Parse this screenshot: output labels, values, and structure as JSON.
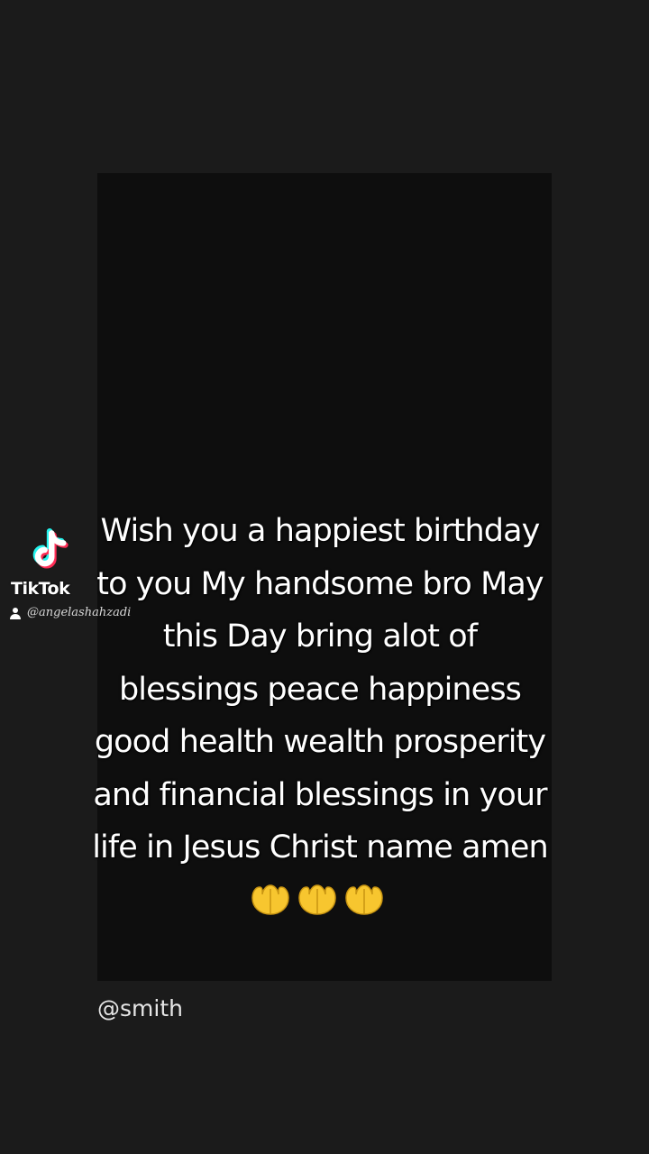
{
  "caption": {
    "lines": [
      "Wish you a happiest birthday",
      "to you My handsome bro May",
      "this Day bring alot of",
      "blessings peace happiness",
      "good health wealth prosperity",
      "and financial blessings in your",
      "life in Jesus Christ name amen"
    ],
    "emoji": [
      "palms-up-together-icon",
      "palms-up-together-icon",
      "palms-up-together-icon"
    ]
  },
  "watermark": {
    "brand": "TikTok",
    "username": "@angelashahzadi",
    "icon": "tiktok-logo-icon",
    "user_icon": "user-icon"
  },
  "mention": "@smith",
  "colors": {
    "background": "#1b1b1b",
    "video_frame": "#0e0e0e",
    "text": "#ffffff",
    "emoji": "#f7c62f",
    "tiktok_cyan": "#25f4ee",
    "tiktok_red": "#fe2c55"
  }
}
